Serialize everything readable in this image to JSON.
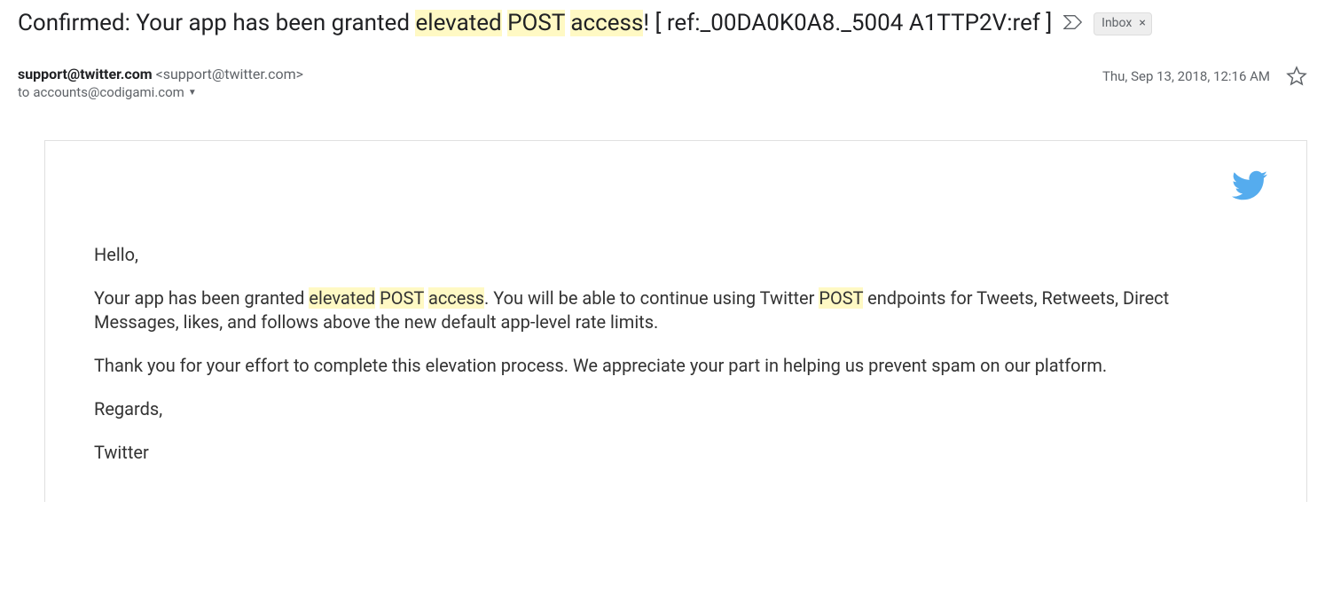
{
  "subject": {
    "pre": "Confirmed: Your app has been granted ",
    "hl1": "elevated",
    "sp1": " ",
    "hl2": "POST",
    "sp2": " ",
    "hl3": "access",
    "post": "! [ ref:_00DA0K0A8._5004 A1TTP2V:ref ]"
  },
  "labels": {
    "inbox": "Inbox",
    "close": "×"
  },
  "header": {
    "sender_name": "support@twitter.com",
    "sender_email": " <support@twitter.com>",
    "recipient_prefix": "to ",
    "recipient": "accounts@codigami.com",
    "timestamp": "Thu, Sep 13, 2018, 12:16 AM"
  },
  "body": {
    "greeting": "Hello,",
    "p1_a": "Your app has been granted ",
    "p1_hl1": "elevated",
    "p1_sp1": " ",
    "p1_hl2": "POST",
    "p1_sp2": " ",
    "p1_hl3": "access",
    "p1_b": ". You will be able to continue using Twitter ",
    "p1_hl4": "POST",
    "p1_c": " endpoints for Tweets, Retweets, Direct Messages, likes, and follows above the new default app-level rate limits.",
    "p2": "Thank you for your effort to complete this elevation process. We appreciate your part in helping us prevent spam on our platform.",
    "regards": "Regards,",
    "signature": "Twitter"
  }
}
